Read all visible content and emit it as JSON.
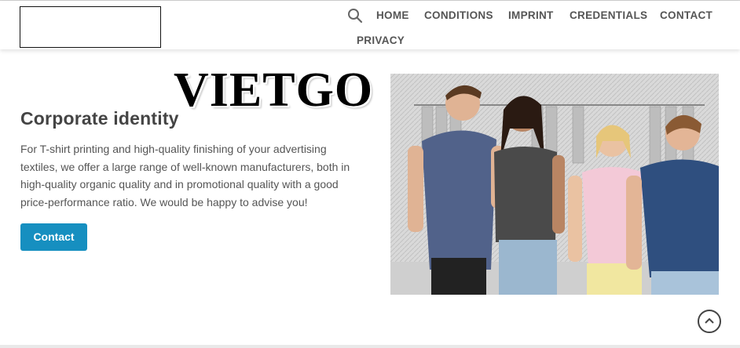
{
  "header": {
    "nav": {
      "home": "HOME",
      "conditions": "CONDITIONS",
      "imprint": "IMPRINT",
      "credentials": "CREDENTIALS",
      "contact": "CONTACT",
      "privacy": "PRIVACY"
    },
    "icons": {
      "search": "search-icon"
    }
  },
  "watermark": "VIETGO",
  "main": {
    "heading": "Corporate identity",
    "paragraph": "For T-shirt printing and high-quality finishing of your advertising textiles, we offer a large range of well-known manufacturers, both in high-quality organic quality and in promotional quality with a good price-performance ratio. We would be happy to advise you!",
    "button_label": "Contact"
  },
  "image": {
    "description": "group-of-models-in-t-shirts"
  },
  "colors": {
    "accent": "#168fc0",
    "nav_text": "#555555",
    "heading": "#444444"
  },
  "scroll_top": {
    "icon": "chevron-up-icon"
  }
}
